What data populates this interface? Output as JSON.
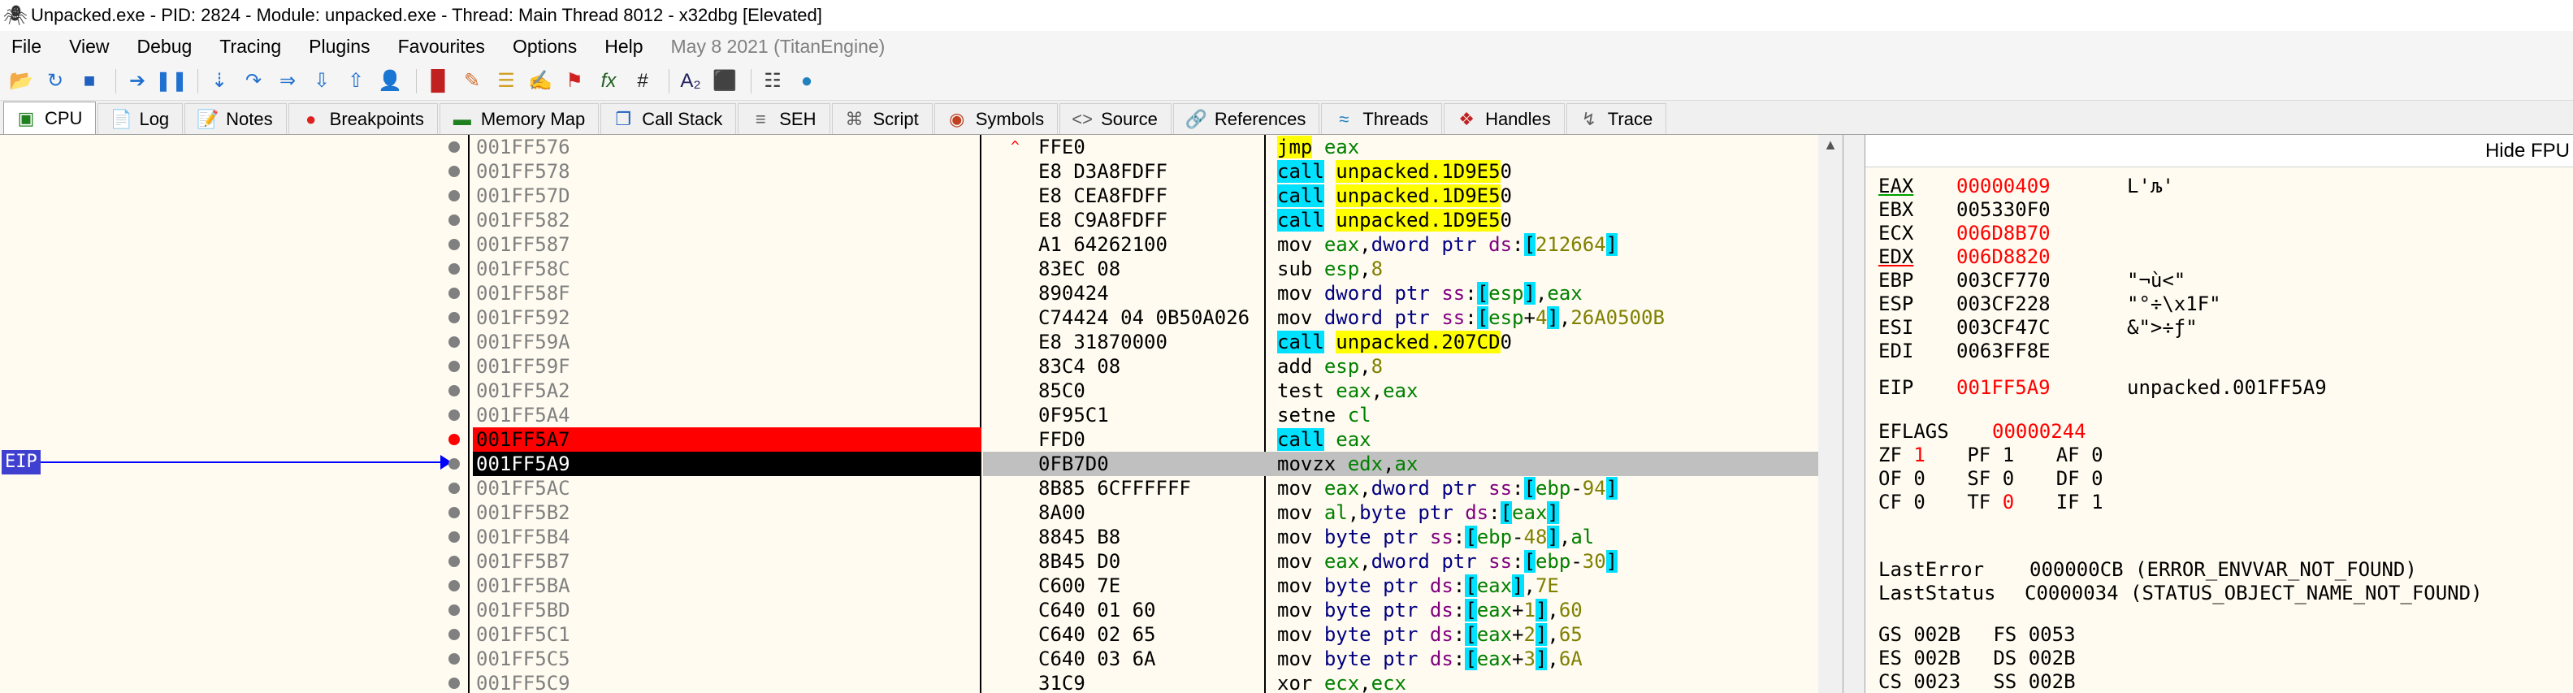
{
  "window": {
    "title": "Unpacked.exe - PID: 2824 - Module: unpacked.exe - Thread: Main Thread 8012 - x32dbg [Elevated]"
  },
  "menu": {
    "items": [
      "File",
      "View",
      "Debug",
      "Tracing",
      "Plugins",
      "Favourites",
      "Options",
      "Help"
    ],
    "build_date": "May 8 2021 (TitanEngine)"
  },
  "toolbar": {
    "buttons": [
      "open-icon",
      "restart-icon",
      "stop-icon",
      "run-icon",
      "pause-icon",
      "step-into-icon",
      "step-over-icon",
      "trace-into-icon",
      "trace-over-icon",
      "execute-till-return-icon",
      "run-to-user-code-icon",
      "scylla-icon",
      "patch-icon",
      "comment-icon",
      "label-icon",
      "bookmark-icon",
      "function-icon",
      "hash-icon",
      "font-icon",
      "memory-icon",
      "calculator-icon",
      "globe-icon"
    ]
  },
  "tabs": [
    {
      "label": "CPU",
      "icon": "cpu-icon",
      "active": true
    },
    {
      "label": "Log",
      "icon": "log-icon"
    },
    {
      "label": "Notes",
      "icon": "notes-icon"
    },
    {
      "label": "Breakpoints",
      "icon": "breakpoint-icon"
    },
    {
      "label": "Memory Map",
      "icon": "memory-map-icon"
    },
    {
      "label": "Call Stack",
      "icon": "call-stack-icon"
    },
    {
      "label": "SEH",
      "icon": "seh-icon"
    },
    {
      "label": "Script",
      "icon": "script-icon"
    },
    {
      "label": "Symbols",
      "icon": "symbols-icon"
    },
    {
      "label": "Source",
      "icon": "source-icon"
    },
    {
      "label": "References",
      "icon": "references-icon"
    },
    {
      "label": "Threads",
      "icon": "threads-icon"
    },
    {
      "label": "Handles",
      "icon": "handles-icon"
    },
    {
      "label": "Trace",
      "icon": "trace-icon"
    }
  ],
  "disasm": {
    "eip_label": "EIP",
    "rows": [
      {
        "addr": "001FF576",
        "bytes": "FFE0",
        "instr": "jmp eax",
        "jump": "^"
      },
      {
        "addr": "001FF578",
        "bytes": "E8 D3A8FDFF",
        "instr": "call unpacked.1D9E50"
      },
      {
        "addr": "001FF57D",
        "bytes": "E8 CEA8FDFF",
        "instr": "call unpacked.1D9E50"
      },
      {
        "addr": "001FF582",
        "bytes": "E8 C9A8FDFF",
        "instr": "call unpacked.1D9E50"
      },
      {
        "addr": "001FF587",
        "bytes": "A1 64262100",
        "instr": "mov eax,dword ptr ds:[212664]"
      },
      {
        "addr": "001FF58C",
        "bytes": "83EC 08",
        "instr": "sub esp,8"
      },
      {
        "addr": "001FF58F",
        "bytes": "890424",
        "instr": "mov dword ptr ss:[esp],eax"
      },
      {
        "addr": "001FF592",
        "bytes": "C74424 04 0B50A026",
        "instr": "mov dword ptr ss:[esp+4],26A0500B"
      },
      {
        "addr": "001FF59A",
        "bytes": "E8 31870000",
        "instr": "call unpacked.207CD0"
      },
      {
        "addr": "001FF59F",
        "bytes": "83C4 08",
        "instr": "add esp,8"
      },
      {
        "addr": "001FF5A2",
        "bytes": "85C0",
        "instr": "test eax,eax"
      },
      {
        "addr": "001FF5A4",
        "bytes": "0F95C1",
        "instr": "setne cl"
      },
      {
        "addr": "001FF5A7",
        "bytes": "FFD0",
        "instr": "call eax",
        "state": "breakpoint"
      },
      {
        "addr": "001FF5A9",
        "bytes": "0FB7D0",
        "instr": "movzx edx,ax",
        "state": "eip"
      },
      {
        "addr": "001FF5AC",
        "bytes": "8B85 6CFFFFFF",
        "instr": "mov eax,dword ptr ss:[ebp-94]"
      },
      {
        "addr": "001FF5B2",
        "bytes": "8A00",
        "instr": "mov al,byte ptr ds:[eax]"
      },
      {
        "addr": "001FF5B4",
        "bytes": "8845 B8",
        "instr": "mov byte ptr ss:[ebp-48],al"
      },
      {
        "addr": "001FF5B7",
        "bytes": "8B45 D0",
        "instr": "mov eax,dword ptr ss:[ebp-30]"
      },
      {
        "addr": "001FF5BA",
        "bytes": "C600 7E",
        "instr": "mov byte ptr ds:[eax],7E"
      },
      {
        "addr": "001FF5BD",
        "bytes": "C640 01 60",
        "instr": "mov byte ptr ds:[eax+1],60"
      },
      {
        "addr": "001FF5C1",
        "bytes": "C640 02 65",
        "instr": "mov byte ptr ds:[eax+2],65"
      },
      {
        "addr": "001FF5C5",
        "bytes": "C640 03 6A",
        "instr": "mov byte ptr ds:[eax+3],6A"
      },
      {
        "addr": "001FF5C9",
        "bytes": "31C9",
        "instr": "xor ecx,ecx"
      }
    ]
  },
  "registers": {
    "hide_fpu_label": "Hide FPU",
    "general": [
      {
        "name": "EAX",
        "value": "00000409",
        "comment": "L'љ'",
        "changed": true,
        "underline": "green"
      },
      {
        "name": "EBX",
        "value": "005330F0",
        "comment": ""
      },
      {
        "name": "ECX",
        "value": "006D8B70",
        "comment": "",
        "changed": true
      },
      {
        "name": "EDX",
        "value": "006D8820",
        "comment": "",
        "changed": true,
        "underline": "red"
      },
      {
        "name": "EBP",
        "value": "003CF770",
        "comment": "\"¬ù<\""
      },
      {
        "name": "ESP",
        "value": "003CF228",
        "comment": "\"°÷\\x1F\""
      },
      {
        "name": "ESI",
        "value": "003CF47C",
        "comment": "&\">÷ƒ\""
      },
      {
        "name": "EDI",
        "value": "0063FF8E",
        "comment": ""
      }
    ],
    "eip": {
      "name": "EIP",
      "value": "001FF5A9",
      "comment": "unpacked.001FF5A9"
    },
    "eflags": {
      "name": "EFLAGS",
      "value": "00000244"
    },
    "flags_rows": [
      [
        {
          "n": "ZF",
          "v": "1",
          "c": true
        },
        {
          "n": "PF",
          "v": "1"
        },
        {
          "n": "AF",
          "v": "0"
        }
      ],
      [
        {
          "n": "OF",
          "v": "0"
        },
        {
          "n": "SF",
          "v": "0"
        },
        {
          "n": "DF",
          "v": "0"
        }
      ],
      [
        {
          "n": "CF",
          "v": "0"
        },
        {
          "n": "TF",
          "v": "0",
          "c": true
        },
        {
          "n": "IF",
          "v": "1"
        }
      ]
    ],
    "last_error": {
      "label": "LastError",
      "value": "000000CB (ERROR_ENVVAR_NOT_FOUND)"
    },
    "last_status": {
      "label": "LastStatus",
      "value": "C0000034 (STATUS_OBJECT_NAME_NOT_FOUND)"
    },
    "segments": [
      [
        {
          "n": "GS",
          "v": "002B"
        },
        {
          "n": "FS",
          "v": "0053"
        }
      ],
      [
        {
          "n": "ES",
          "v": "002B"
        },
        {
          "n": "DS",
          "v": "002B"
        }
      ],
      [
        {
          "n": "CS",
          "v": "0023"
        },
        {
          "n": "SS",
          "v": "002B"
        }
      ]
    ]
  }
}
